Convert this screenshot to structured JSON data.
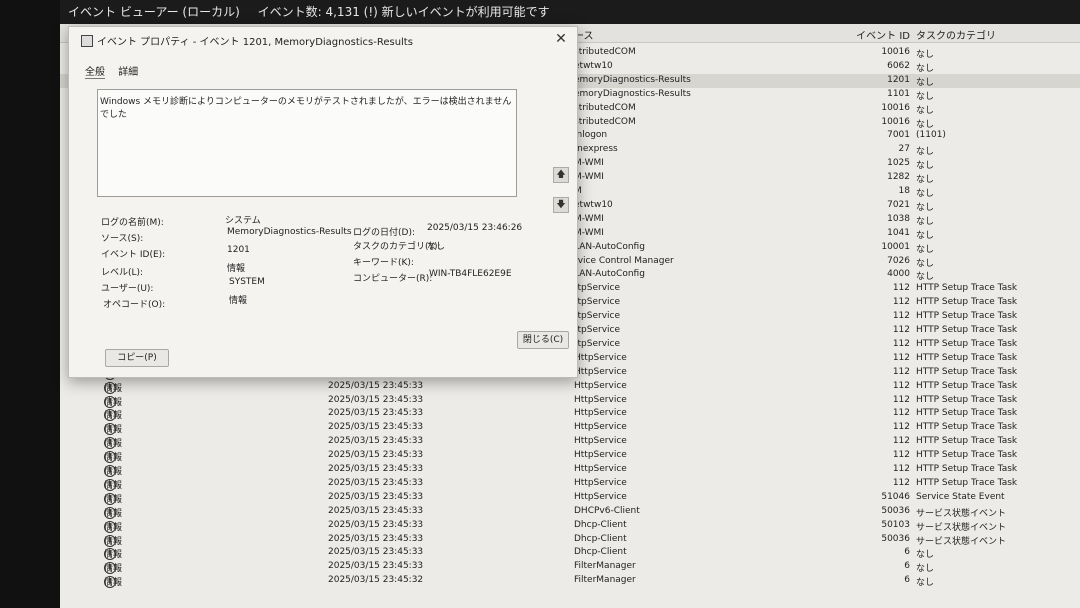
{
  "topbar": {
    "title": "イベント ビューアー (ローカル)",
    "event_count": "イベント数: 4,131 (!) 新しいイベントが利用可能です"
  },
  "columns": {
    "source": "ース",
    "event_id": "イベント ID",
    "task_category": "タスクのカテゴリ"
  },
  "rows": [
    {
      "level": "",
      "date": "",
      "source": "stributedCOM",
      "id": "10016",
      "task": "なし"
    },
    {
      "level": "",
      "date": "",
      "source": "etwtw10",
      "id": "6062",
      "task": "なし"
    },
    {
      "level": "",
      "date": "",
      "source": "emoryDiagnostics-Results",
      "id": "1201",
      "task": "なし",
      "selected": true
    },
    {
      "level": "",
      "date": "",
      "source": "emoryDiagnostics-Results",
      "id": "1101",
      "task": "なし"
    },
    {
      "level": "",
      "date": "",
      "source": "stributedCOM",
      "id": "10016",
      "task": "なし"
    },
    {
      "level": "",
      "date": "",
      "source": "stributedCOM",
      "id": "10016",
      "task": "なし"
    },
    {
      "level": "",
      "date": "",
      "source": "inlogon",
      "id": "7001",
      "task": "(1101)"
    },
    {
      "level": "",
      "date": "",
      "source": "fnexpress",
      "id": "27",
      "task": "なし"
    },
    {
      "level": "",
      "date": "",
      "source": "M-WMI",
      "id": "1025",
      "task": "なし"
    },
    {
      "level": "",
      "date": "",
      "source": "M-WMI",
      "id": "1282",
      "task": "なし"
    },
    {
      "level": "",
      "date": "",
      "source": "M",
      "id": "18",
      "task": "なし"
    },
    {
      "level": "",
      "date": "",
      "source": "etwtw10",
      "id": "7021",
      "task": "なし"
    },
    {
      "level": "",
      "date": "",
      "source": "M-WMI",
      "id": "1038",
      "task": "なし"
    },
    {
      "level": "",
      "date": "",
      "source": "M-WMI",
      "id": "1041",
      "task": "なし"
    },
    {
      "level": "",
      "date": "",
      "source": "LAN-AutoConfig",
      "id": "10001",
      "task": "なし"
    },
    {
      "level": "",
      "date": "",
      "source": "rvice Control Manager",
      "id": "7026",
      "task": "なし"
    },
    {
      "level": "",
      "date": "",
      "source": "LAN-AutoConfig",
      "id": "4000",
      "task": "なし"
    },
    {
      "level": "",
      "date": "",
      "source": "ttpService",
      "id": "112",
      "task": "HTTP Setup Trace Task"
    },
    {
      "level": "",
      "date": "",
      "source": "ttpService",
      "id": "112",
      "task": "HTTP Setup Trace Task"
    },
    {
      "level": "",
      "date": "",
      "source": "ttpService",
      "id": "112",
      "task": "HTTP Setup Trace Task"
    },
    {
      "level": "",
      "date": "",
      "source": "ttpService",
      "id": "112",
      "task": "HTTP Setup Trace Task"
    },
    {
      "level": "",
      "date": "",
      "source": "ttpService",
      "id": "112",
      "task": "HTTP Setup Trace Task"
    },
    {
      "level": "",
      "date": "",
      "source": "HttpService",
      "id": "112",
      "task": "HTTP Setup Trace Task"
    },
    {
      "level": "情報",
      "date": "2025/03/15 23:45:33",
      "source": "HttpService",
      "id": "112",
      "task": "HTTP Setup Trace Task"
    },
    {
      "level": "情報",
      "date": "2025/03/15 23:45:33",
      "source": "HttpService",
      "id": "112",
      "task": "HTTP Setup Trace Task"
    },
    {
      "level": "情報",
      "date": "2025/03/15 23:45:33",
      "source": "HttpService",
      "id": "112",
      "task": "HTTP Setup Trace Task"
    },
    {
      "level": "情報",
      "date": "2025/03/15 23:45:33",
      "source": "HttpService",
      "id": "112",
      "task": "HTTP Setup Trace Task"
    },
    {
      "level": "情報",
      "date": "2025/03/15 23:45:33",
      "source": "HttpService",
      "id": "112",
      "task": "HTTP Setup Trace Task"
    },
    {
      "level": "情報",
      "date": "2025/03/15 23:45:33",
      "source": "HttpService",
      "id": "112",
      "task": "HTTP Setup Trace Task"
    },
    {
      "level": "情報",
      "date": "2025/03/15 23:45:33",
      "source": "HttpService",
      "id": "112",
      "task": "HTTP Setup Trace Task"
    },
    {
      "level": "情報",
      "date": "2025/03/15 23:45:33",
      "source": "HttpService",
      "id": "112",
      "task": "HTTP Setup Trace Task"
    },
    {
      "level": "情報",
      "date": "2025/03/15 23:45:33",
      "source": "HttpService",
      "id": "112",
      "task": "HTTP Setup Trace Task"
    },
    {
      "level": "情報",
      "date": "2025/03/15 23:45:33",
      "source": "HttpService",
      "id": "51046",
      "task": "Service State Event"
    },
    {
      "level": "情報",
      "date": "2025/03/15 23:45:33",
      "source": "DHCPv6-Client",
      "id": "50036",
      "task": "サービス状態イベント"
    },
    {
      "level": "情報",
      "date": "2025/03/15 23:45:33",
      "source": "Dhcp-Client",
      "id": "50103",
      "task": "サービス状態イベント"
    },
    {
      "level": "情報",
      "date": "2025/03/15 23:45:33",
      "source": "Dhcp-Client",
      "id": "50036",
      "task": "サービス状態イベント"
    },
    {
      "level": "情報",
      "date": "2025/03/15 23:45:33",
      "source": "Dhcp-Client",
      "id": "6",
      "task": "なし"
    },
    {
      "level": "情報",
      "date": "2025/03/15 23:45:33",
      "source": "FilterManager",
      "id": "6",
      "task": "なし"
    },
    {
      "level": "情報",
      "date": "2025/03/15 23:45:32",
      "source": "FilterManager",
      "id": "6",
      "task": "なし"
    }
  ],
  "dialog": {
    "title": "イベント プロパティ - イベント 1201, MemoryDiagnostics-Results",
    "close_glyph": "✕",
    "tabs": [
      "全般",
      "詳細"
    ],
    "message": "Windows メモリ診断によりコンピューターのメモリがテストされましたが、エラーは検出されませんでした",
    "fields": {
      "log_name_label": "ログの名前(M):",
      "log_name": "システム",
      "source_label": "ソース(S):",
      "source": "MemoryDiagnostics-Results",
      "log_date_label": "ログの日付(D):",
      "log_date": "2025/03/15 23:46:26",
      "event_id_label": "イベント ID(E):",
      "event_id": "1201",
      "task_label": "タスクのカテゴリ(Y):",
      "task": "なし",
      "level_label": "レベル(L):",
      "level": "情報",
      "keyword_label": "キーワード(K):",
      "keyword": "",
      "user_label": "ユーザー(U):",
      "user": "SYSTEM",
      "computer_label": "コンピューター(R):",
      "computer": "WIN-TB4FLE62E9E",
      "opcode_label": "オペコード(O):",
      "opcode": "情報"
    },
    "copy_button": "コピー(P)",
    "close_button": "閉じる(C)",
    "arrow_up": "🡅",
    "arrow_down": "🡇"
  },
  "icons": {
    "info": "i"
  }
}
